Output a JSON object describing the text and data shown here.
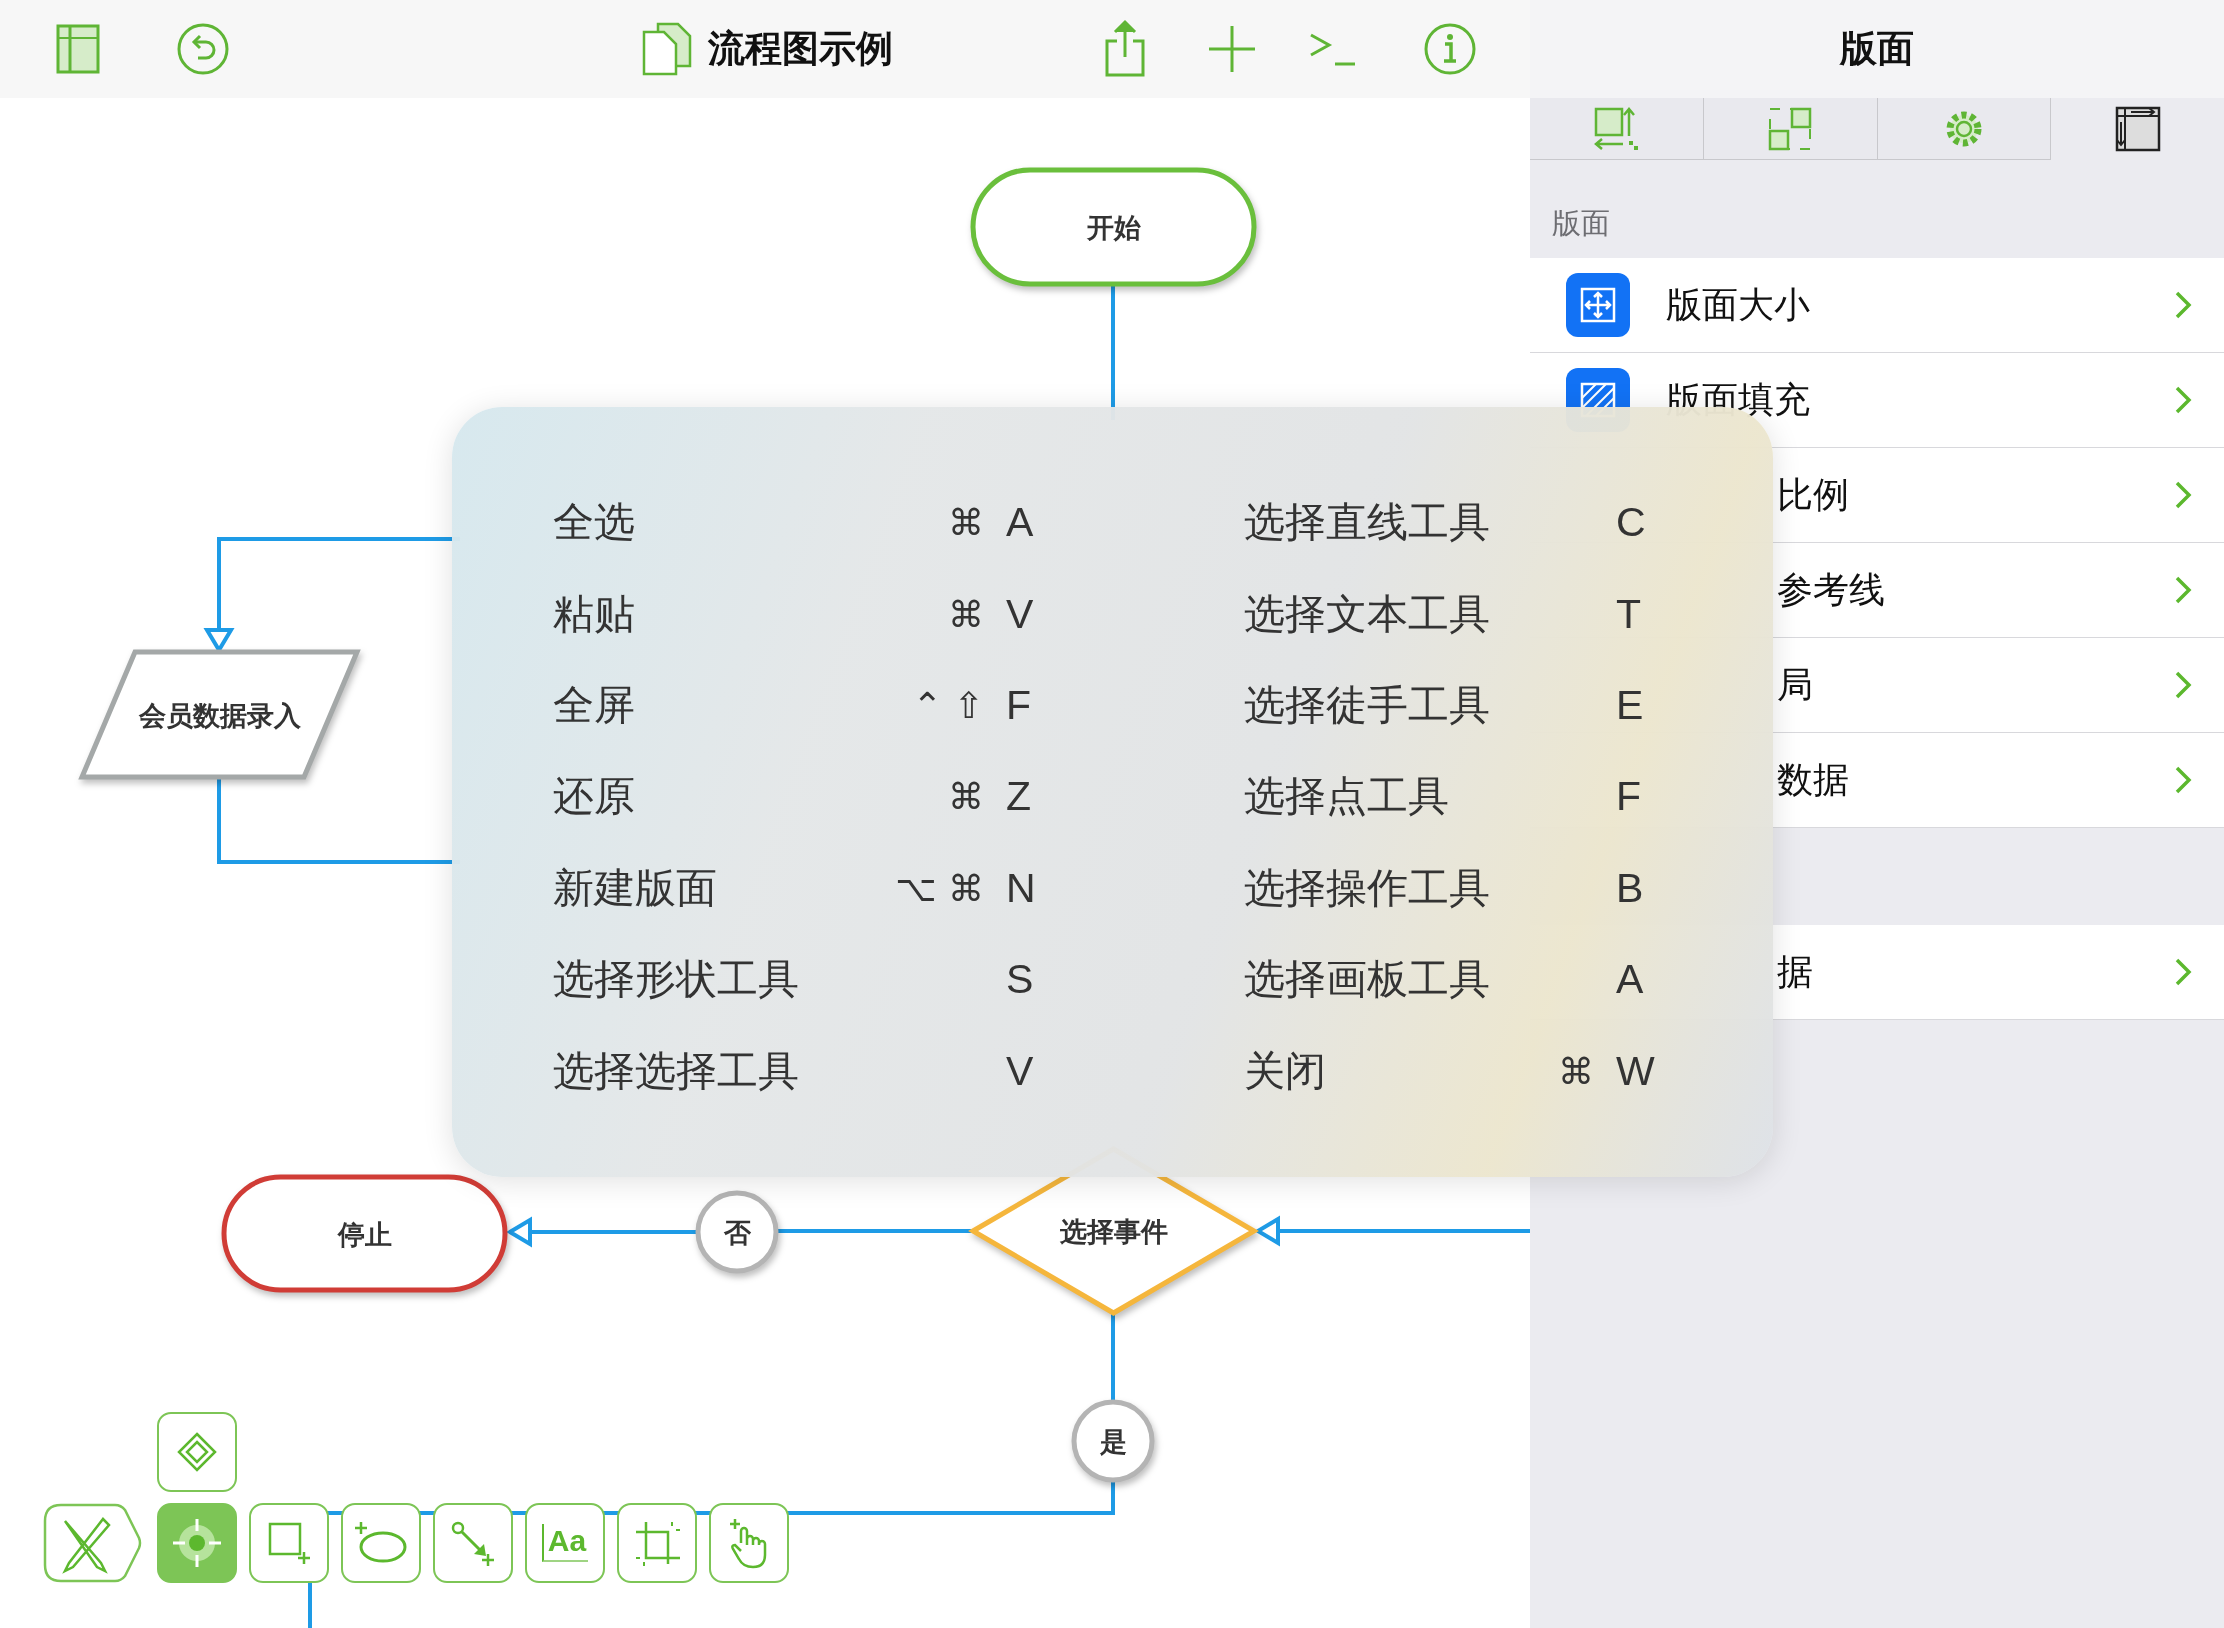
{
  "toolbar": {
    "title": "流程图示例"
  },
  "canvas": {
    "nodes": [
      {
        "kind": "terminal",
        "label": "开始",
        "color": "#6abf3c"
      },
      {
        "kind": "data",
        "label": "会员数据录入",
        "color": "#a4a8a8"
      },
      {
        "kind": "terminal",
        "label": "停止",
        "color": "#d03c36"
      },
      {
        "kind": "connector",
        "label": "否",
        "color": "#b4b4b4"
      },
      {
        "kind": "decision",
        "label": "选择事件",
        "color": "#f5b63c"
      },
      {
        "kind": "connector",
        "label": "是",
        "color": "#b4b4b4"
      }
    ]
  },
  "tools": [
    {
      "selected": false
    },
    {
      "selected": true
    },
    {
      "selected": false
    },
    {
      "selected": false
    },
    {
      "selected": false
    },
    {
      "selected": false,
      "label": "Aa"
    },
    {
      "selected": false
    },
    {
      "selected": false
    }
  ],
  "shortcuts": {
    "columns": [
      [
        {
          "label": "全选",
          "modifiers": "⌘",
          "key": "A"
        },
        {
          "label": "粘贴",
          "modifiers": "⌘",
          "key": "V"
        },
        {
          "label": "全屏",
          "modifiers": "⌃ ⇧",
          "key": "F"
        },
        {
          "label": "还原",
          "modifiers": "⌘",
          "key": "Z"
        },
        {
          "label": "新建版面",
          "modifiers": "⌥ ⌘",
          "key": "N"
        },
        {
          "label": "选择形状工具",
          "key": "S"
        },
        {
          "label": "选择选择工具",
          "key": "V"
        }
      ],
      [
        {
          "label": "选择直线工具",
          "key": "C"
        },
        {
          "label": "选择文本工具",
          "key": "T"
        },
        {
          "label": "选择徒手工具",
          "key": "E"
        },
        {
          "label": "选择点工具",
          "key": "F"
        },
        {
          "label": "选择操作工具",
          "key": "B"
        },
        {
          "label": "选择画板工具",
          "key": "A"
        },
        {
          "label": "关闭",
          "modifiers": "⌘",
          "key": "W"
        }
      ]
    ]
  },
  "inspector": {
    "title": "版面",
    "tabs": [
      {
        "selected": false
      },
      {
        "selected": false
      },
      {
        "selected": false
      },
      {
        "selected": true
      }
    ],
    "sections": [
      {
        "header": "版面",
        "rows": [
          {
            "kind": "icon",
            "label": "版面大小"
          },
          {
            "kind": "icon",
            "label": "版面填充"
          },
          {
            "kind": "partial",
            "label": "比例"
          },
          {
            "kind": "partial",
            "label": "参考线"
          },
          {
            "kind": "partial",
            "label": "局"
          },
          {
            "kind": "partial",
            "label": "数据"
          }
        ]
      },
      {
        "rows": [
          {
            "kind": "partial",
            "label": "据"
          }
        ]
      }
    ]
  }
}
